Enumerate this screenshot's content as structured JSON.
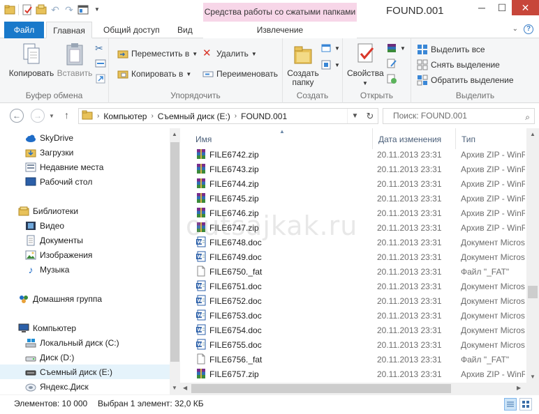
{
  "window": {
    "title": "FOUND.001",
    "context_tab_header": "Средства работы со сжатыми папками",
    "minimize": "─",
    "maximize": "☐",
    "close": "✕"
  },
  "tabs": {
    "file": "Файл",
    "home": "Главная",
    "share": "Общий доступ",
    "view": "Вид",
    "extract": "Извлечение"
  },
  "ribbon": {
    "clipboard": {
      "label": "Буфер обмена",
      "copy": "Копировать",
      "paste": "Вставить"
    },
    "organize": {
      "label": "Упорядочить",
      "move_to": "Переместить в",
      "copy_to": "Копировать в",
      "delete": "Удалить",
      "rename": "Переименовать"
    },
    "new": {
      "label": "Создать",
      "new_folder_line1": "Создать",
      "new_folder_line2": "папку"
    },
    "open": {
      "label": "Открыть",
      "properties": "Свойства"
    },
    "select": {
      "label": "Выделить",
      "select_all": "Выделить все",
      "select_none": "Снять выделение",
      "invert": "Обратить выделение"
    }
  },
  "address": {
    "crumbs": [
      "Компьютер",
      "Съемный диск (E:)",
      "FOUND.001"
    ],
    "search_placeholder": "Поиск: FOUND.001"
  },
  "navpane": {
    "items": [
      {
        "label": "SkyDrive",
        "icon": "cloud-icon"
      },
      {
        "label": "Загрузки",
        "icon": "downloads-folder-icon"
      },
      {
        "label": "Недавние места",
        "icon": "recent-places-icon"
      },
      {
        "label": "Рабочий стол",
        "icon": "desktop-icon"
      },
      {
        "label": "Библиотеки",
        "icon": "libraries-icon"
      },
      {
        "label": "Видео",
        "icon": "video-icon"
      },
      {
        "label": "Документы",
        "icon": "documents-icon"
      },
      {
        "label": "Изображения",
        "icon": "pictures-icon"
      },
      {
        "label": "Музыка",
        "icon": "music-icon"
      },
      {
        "label": "Домашняя группа",
        "icon": "homegroup-icon"
      },
      {
        "label": "Компьютер",
        "icon": "computer-icon"
      },
      {
        "label": "Локальный диск (C:)",
        "icon": "system-drive-icon"
      },
      {
        "label": "Диск (D:)",
        "icon": "drive-icon"
      },
      {
        "label": "Съемный диск (E:)",
        "icon": "removable-drive-icon"
      },
      {
        "label": "Яндекс.Диск",
        "icon": "yandex-disk-icon"
      }
    ]
  },
  "filelist": {
    "columns": {
      "name": "Имя",
      "date": "Дата изменения",
      "type": "Тип"
    },
    "rows": [
      {
        "name": "FILE6742.zip",
        "date": "20.11.2013 23:31",
        "type": "Архив ZIP - WinRAR",
        "icon": "zip-archive-icon"
      },
      {
        "name": "FILE6743.zip",
        "date": "20.11.2013 23:31",
        "type": "Архив ZIP - WinRAR",
        "icon": "zip-archive-icon"
      },
      {
        "name": "FILE6744.zip",
        "date": "20.11.2013 23:31",
        "type": "Архив ZIP - WinRAR",
        "icon": "zip-archive-icon"
      },
      {
        "name": "FILE6745.zip",
        "date": "20.11.2013 23:31",
        "type": "Архив ZIP - WinRAR",
        "icon": "zip-archive-icon"
      },
      {
        "name": "FILE6746.zip",
        "date": "20.11.2013 23:31",
        "type": "Архив ZIP - WinRAR",
        "icon": "zip-archive-icon"
      },
      {
        "name": "FILE6747.zip",
        "date": "20.11.2013 23:31",
        "type": "Архив ZIP - WinRAR",
        "icon": "zip-archive-icon"
      },
      {
        "name": "FILE6748.doc",
        "date": "20.11.2013 23:31",
        "type": "Документ Microsoft",
        "icon": "word-doc-icon"
      },
      {
        "name": "FILE6749.doc",
        "date": "20.11.2013 23:31",
        "type": "Документ Microsoft",
        "icon": "word-doc-icon"
      },
      {
        "name": "FILE6750._fat",
        "date": "20.11.2013 23:31",
        "type": "Файл \"_FAT\"",
        "icon": "blank-file-icon"
      },
      {
        "name": "FILE6751.doc",
        "date": "20.11.2013 23:31",
        "type": "Документ Microsoft",
        "icon": "word-doc-icon"
      },
      {
        "name": "FILE6752.doc",
        "date": "20.11.2013 23:31",
        "type": "Документ Microsoft",
        "icon": "word-doc-icon"
      },
      {
        "name": "FILE6753.doc",
        "date": "20.11.2013 23:31",
        "type": "Документ Microsoft",
        "icon": "word-doc-icon"
      },
      {
        "name": "FILE6754.doc",
        "date": "20.11.2013 23:31",
        "type": "Документ Microsoft",
        "icon": "word-doc-icon"
      },
      {
        "name": "FILE6755.doc",
        "date": "20.11.2013 23:31",
        "type": "Документ Microsoft",
        "icon": "word-doc-icon"
      },
      {
        "name": "FILE6756._fat",
        "date": "20.11.2013 23:31",
        "type": "Файл \"_FAT\"",
        "icon": "blank-file-icon"
      },
      {
        "name": "FILE6757.zip",
        "date": "20.11.2013 23:31",
        "type": "Архив ZIP - WinRAR",
        "icon": "zip-archive-icon"
      }
    ]
  },
  "watermark": "outsajkak.ru",
  "status": {
    "count": "Элементов: 10 000",
    "selected": "Выбран 1 элемент: 32,0 КБ"
  },
  "colors": {
    "file_tab": "#1979ca",
    "context_tab": "#f7d6e8",
    "close_button": "#c7463a",
    "selection": "#e5f3fb"
  }
}
